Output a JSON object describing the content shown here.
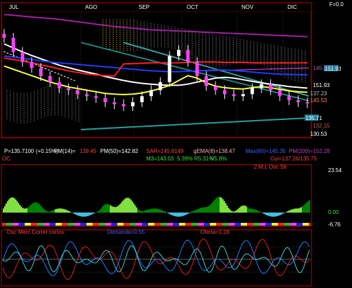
{
  "header": {
    "months": [
      "JUL",
      "AGO",
      "SEP",
      "OCT",
      "NOV",
      "DIC"
    ],
    "f_readout": "F=0.0"
  },
  "price_axis": {
    "labels": [
      "151.93",
      "145.53",
      "130.53"
    ],
    "boxed": [
      "151.93",
      "135.71"
    ],
    "markers": [
      "145.47",
      "137.23",
      "132.15"
    ]
  },
  "info_line": {
    "p": "P=135.7100",
    "change": "(+0.15%)",
    "pm14": "PM(14)=",
    "pm14_val": "139.45",
    "pm50": "PM(50)=142.82",
    "sar": "SAR=145.8149",
    "gema": "gEMA(8)=138.47",
    "max": "Max(60)=145.35",
    "pm200": "PM(200)=152.28",
    "oc": "OC",
    "m3": "M3=143.03",
    "pct1": "5.39%",
    "r": "R5.31%",
    "v": "V5.8%",
    "gyi": "Gyi=137.26/135.75"
  },
  "macd_panel": {
    "title": "2 M.c Osc Str",
    "axis": [
      "23.54",
      "0.00",
      "-6.76"
    ],
    "colors": {
      "light": "#80e040",
      "dark": "#008000",
      "neg": "#40c0e0"
    }
  },
  "osc_panel": {
    "title": "Osc Merc Correr cortos",
    "mid": "Demanda=0.55",
    "right": "Oferta=1.16",
    "colors": {
      "osc_a": "#e02020",
      "osc_b": "#2080ff",
      "osc_c": "#40d0d0"
    }
  },
  "chart_data": {
    "type": "line",
    "title": "",
    "xlabel": "",
    "ylabel": "",
    "ylim": [
      128,
      158
    ],
    "grid": false,
    "series": [
      {
        "name": "PM(14)",
        "color": "#ffffff",
        "values": [
          150.5,
          149.5,
          148.5,
          147.6,
          146.8,
          146.0,
          145.2,
          144.6,
          144.0,
          143.5,
          143.0,
          142.4,
          141.9,
          141.4,
          141.0,
          140.7,
          140.5,
          140.3,
          140.2,
          140.2,
          140.5,
          141.0,
          141.5,
          142.0,
          142.2,
          142.0,
          141.6,
          141.2,
          140.8,
          140.5,
          140.2,
          139.9,
          139.7,
          139.5
        ]
      },
      {
        "name": "PM(50)",
        "color": "#1e3cff",
        "values": [
          147.5,
          147.2,
          146.9,
          146.6,
          146.3,
          146.0,
          145.8,
          145.6,
          145.4,
          145.2,
          145.0,
          144.8,
          144.6,
          144.4,
          144.2,
          144.0,
          143.8,
          143.7,
          143.6,
          143.6,
          143.7,
          143.8,
          143.9,
          144.0,
          144.0,
          143.9,
          143.7,
          143.5,
          143.3,
          143.1,
          143.0,
          142.9,
          142.85,
          142.82
        ]
      },
      {
        "name": "PM(200)",
        "color": "#a020a0",
        "values": [
          157.8,
          157.6,
          157.4,
          157.2,
          157.0,
          156.8,
          156.6,
          156.3,
          156.0,
          155.7,
          155.4,
          155.1,
          154.8,
          154.6,
          154.4,
          154.2,
          154.0,
          153.9,
          153.8,
          153.7,
          153.6,
          153.5,
          153.4,
          153.3,
          153.2,
          153.1,
          153.0,
          152.9,
          152.8,
          152.7,
          152.6,
          152.5,
          152.4,
          152.28
        ]
      },
      {
        "name": "SAR",
        "color": "#ff2020",
        "values": [
          147.0,
          146.6,
          146.2,
          145.8,
          145.3,
          144.8,
          144.3,
          143.8,
          143.4,
          143.0,
          142.8,
          142.6,
          142.5,
          145.5,
          145.6,
          145.7,
          145.8,
          145.8,
          145.8,
          145.8,
          145.9,
          146.0,
          146.0,
          146.0,
          145.9,
          145.9,
          145.9,
          145.8,
          145.8,
          145.8,
          145.8,
          145.8,
          145.8,
          145.81
        ]
      },
      {
        "name": "gEMA(8)",
        "color": "#ffff40",
        "values": [
          145.0,
          144.2,
          143.4,
          142.6,
          141.8,
          141.0,
          140.4,
          139.8,
          139.4,
          139.0,
          138.6,
          138.2,
          138.0,
          137.9,
          138.0,
          138.3,
          138.8,
          139.4,
          140.2,
          141.4,
          142.6,
          142.0,
          140.8,
          140.0,
          139.6,
          139.4,
          139.3,
          139.6,
          139.9,
          139.6,
          139.2,
          138.8,
          138.6,
          138.47
        ]
      }
    ],
    "candles_close": [
      152.0,
      148.5,
      146.0,
      144.5,
      142.5,
      141.0,
      139.5,
      139.0,
      138.0,
      137.5,
      137.0,
      136.0,
      135.5,
      135.0,
      136.0,
      137.5,
      139.0,
      141.0,
      147.5,
      149.0,
      146.0,
      142.5,
      140.0,
      139.0,
      138.0,
      137.5,
      138.0,
      139.5,
      140.5,
      139.0,
      137.5,
      136.5,
      136.0,
      135.71
    ]
  }
}
